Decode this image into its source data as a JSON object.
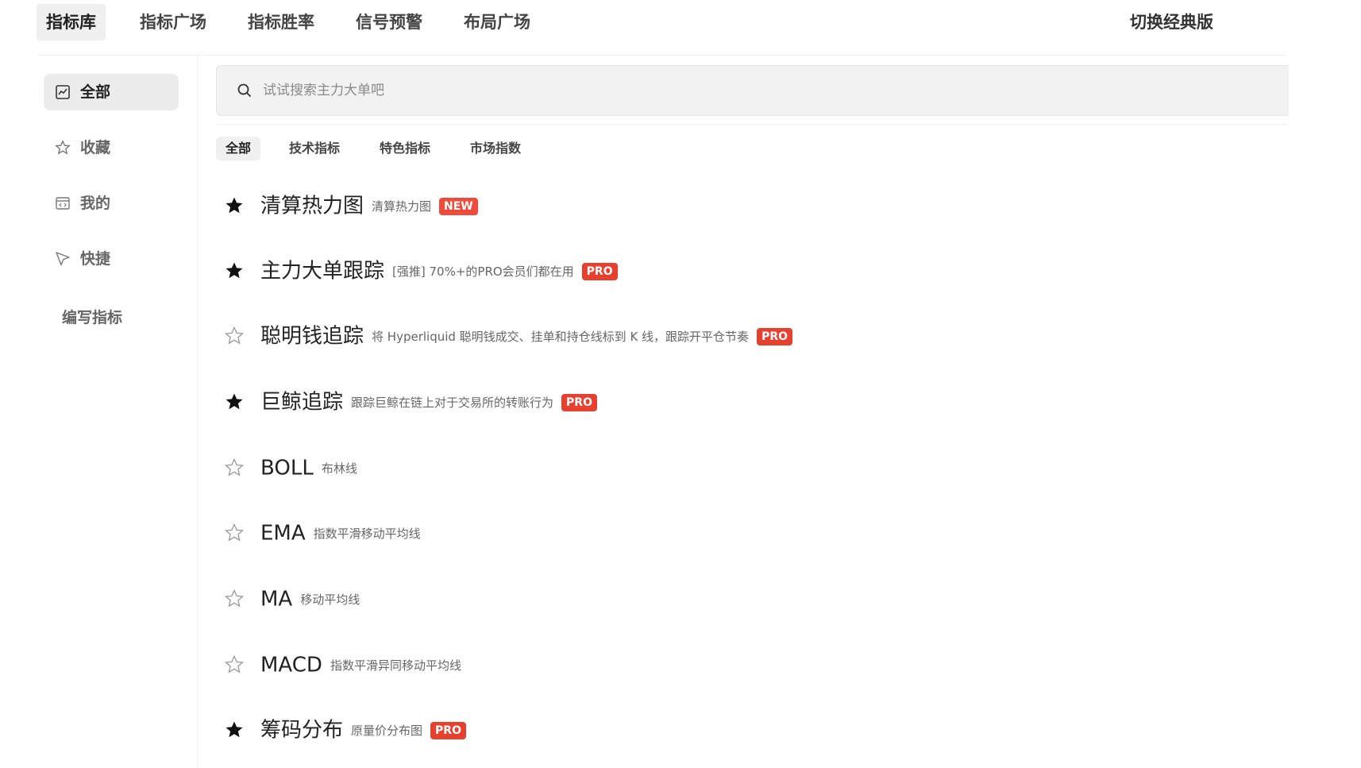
{
  "top_nav": {
    "tabs": [
      "指标库",
      "指标广场",
      "指标胜率",
      "信号预警",
      "布局广场"
    ],
    "active_index": 0,
    "switch_classic": "切换经典版"
  },
  "sidebar": {
    "items": [
      {
        "label": "全部",
        "icon": "chart-icon",
        "active": true
      },
      {
        "label": "收藏",
        "icon": "star-outline-icon",
        "active": false
      },
      {
        "label": "我的",
        "icon": "code-window-icon",
        "active": false
      },
      {
        "label": "快捷",
        "icon": "cursor-arrow-icon",
        "active": false
      }
    ],
    "write_indicator": "编写指标"
  },
  "search": {
    "placeholder": "试试搜索主力大单吧"
  },
  "filter_tabs": {
    "tabs": [
      "全部",
      "技术指标",
      "特色指标",
      "市场指数"
    ],
    "active_index": 0
  },
  "indicators": [
    {
      "name": "清算热力图",
      "desc": "清算热力图",
      "badge": "NEW",
      "starred": true
    },
    {
      "name": "主力大单跟踪",
      "desc": "[强推] 70%+的PRO会员们都在用",
      "badge": "PRO",
      "starred": true
    },
    {
      "name": "聪明钱追踪",
      "desc": "将 Hyperliquid 聪明钱成交、挂单和持仓线标到 K 线，跟踪开平仓节奏",
      "badge": "PRO",
      "starred": false
    },
    {
      "name": "巨鲸追踪",
      "desc": "跟踪巨鲸在链上对于交易所的转账行为",
      "badge": "PRO",
      "starred": true
    },
    {
      "name": "BOLL",
      "desc": "布林线",
      "badge": "",
      "starred": false
    },
    {
      "name": "EMA",
      "desc": "指数平滑移动平均线",
      "badge": "",
      "starred": false
    },
    {
      "name": "MA",
      "desc": "移动平均线",
      "badge": "",
      "starred": false
    },
    {
      "name": "MACD",
      "desc": "指数平滑异同移动平均线",
      "badge": "",
      "starred": false
    },
    {
      "name": "筹码分布",
      "desc": "原量价分布图",
      "badge": "PRO",
      "starred": true
    }
  ],
  "colors": {
    "badge_bg": "#e8402f",
    "active_bg": "#f0f0f0",
    "star_filled": "#111111",
    "star_outline": "#999999"
  }
}
